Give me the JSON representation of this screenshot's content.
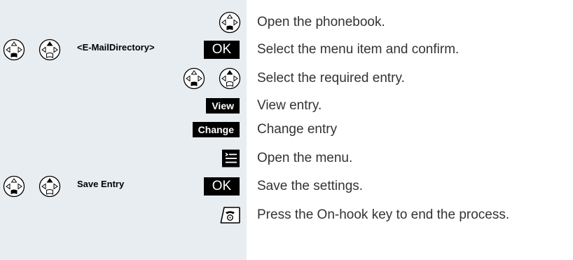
{
  "panel_color": "#e8edf1",
  "steps": [
    {
      "icons": [
        "control-key-down-icon"
      ],
      "instruction": "Open the phonebook."
    },
    {
      "icons": [
        "control-key-down-icon",
        "control-key-up-icon"
      ],
      "display_text": "<E-MailDirectory>",
      "key_label": "OK",
      "instruction": "Select the menu item and confirm."
    },
    {
      "icons": [
        "control-key-down-icon",
        "control-key-up-icon"
      ],
      "instruction": "Select the required entry."
    },
    {
      "softkey": "View",
      "instruction": "View entry."
    },
    {
      "softkey": "Change",
      "instruction": "Change entry"
    },
    {
      "icons": [
        "menu-key-icon"
      ],
      "instruction": "Open the menu."
    },
    {
      "icons": [
        "control-key-down-icon",
        "control-key-up-icon"
      ],
      "display_text": "Save Entry",
      "key_label": "OK",
      "instruction": "Save the settings."
    },
    {
      "icons": [
        "on-hook-key-icon"
      ],
      "instruction": "Press the On-hook key to end the process."
    }
  ]
}
